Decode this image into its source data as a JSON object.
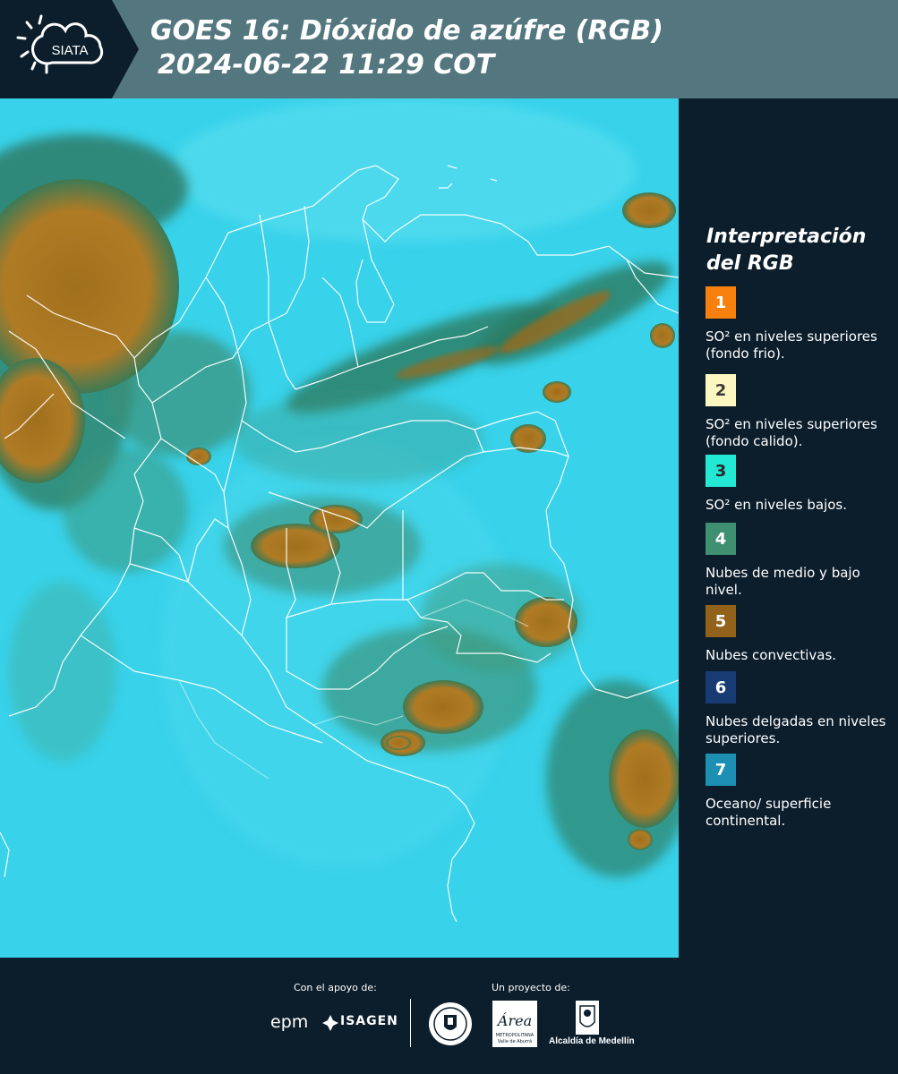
{
  "header": {
    "logo_text": "SIATA",
    "title_line1": "GOES 16: Dióxido de azúfre (RGB)",
    "title_line2": "2024-06-22 11:29 COT"
  },
  "map": {
    "image": "GOES-16 SO2 RGB satellite composite over Colombia with white administrative boundaries"
  },
  "legend": {
    "title": "Interpretación del RGB",
    "items": [
      {
        "number": "1",
        "color": "#f7800f",
        "number_color": "#ffffff",
        "text": "SO² en niveles superiores (fondo frio)."
      },
      {
        "number": "2",
        "color": "#fcf7c0",
        "number_color": "#3a3a3a",
        "text": "SO² en niveles superiores (fondo calido)."
      },
      {
        "number": "3",
        "color": "#22e8d4",
        "number_color": "#2a2a2a",
        "text": "SO² en niveles bajos."
      },
      {
        "number": "4",
        "color": "#3f9071",
        "number_color": "#ffffff",
        "text": "Nubes de medio y bajo nivel."
      },
      {
        "number": "5",
        "color": "#92621a",
        "number_color": "#ffffff",
        "text": "Nubes convectivas."
      },
      {
        "number": "6",
        "color": "#173b72",
        "number_color": "#ffffff",
        "text": "Nubes delgadas en niveles superiores."
      },
      {
        "number": "7",
        "color": "#1c8fb3",
        "number_color": "#ffffff",
        "text": "Oceano/ superficie continental."
      }
    ]
  },
  "footer": {
    "support_label": "Con el apoyo de:",
    "project_label": "Un proyecto de:",
    "epm_logo": "epm",
    "isagen_logo": "ISAGEN",
    "area_logo": "Área",
    "area_sub": "METROPOLITANA",
    "area_sub2": "Valle de Aburrá",
    "alcaldia_label": "Alcaldía de Medellín"
  }
}
